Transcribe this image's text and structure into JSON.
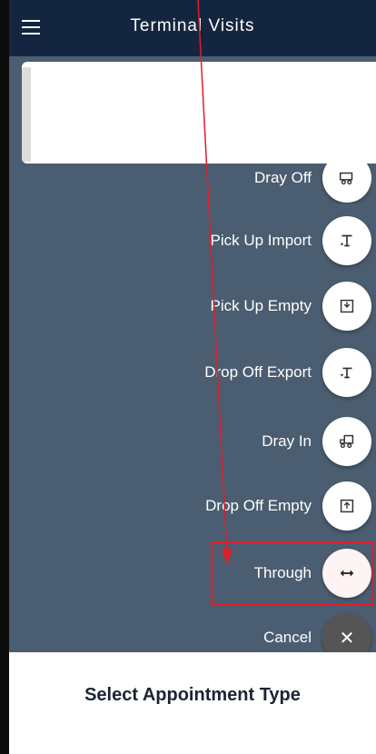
{
  "header": {
    "title": "Terminal Visits",
    "menu_icon": "hamburger-icon"
  },
  "menu": {
    "items": [
      {
        "label": "Dray Off",
        "icon": "dray-off-icon"
      },
      {
        "label": "Pick Up Import",
        "icon": "pick-up-import-icon"
      },
      {
        "label": "Pick Up Empty",
        "icon": "pick-up-empty-icon"
      },
      {
        "label": "Drop Off Export",
        "icon": "drop-off-export-icon"
      },
      {
        "label": "Dray In",
        "icon": "dray-in-icon"
      },
      {
        "label": "Drop Off Empty",
        "icon": "drop-off-empty-icon"
      },
      {
        "label": "Through",
        "icon": "two-way-arrow-icon"
      },
      {
        "label": "Cancel",
        "icon": "close-icon"
      }
    ]
  },
  "sheet": {
    "title": "Select Appointment Type"
  },
  "colors": {
    "header_bg": "#14263f",
    "overlay_bg": "#4b5d70",
    "highlight": "#e21b2b"
  }
}
